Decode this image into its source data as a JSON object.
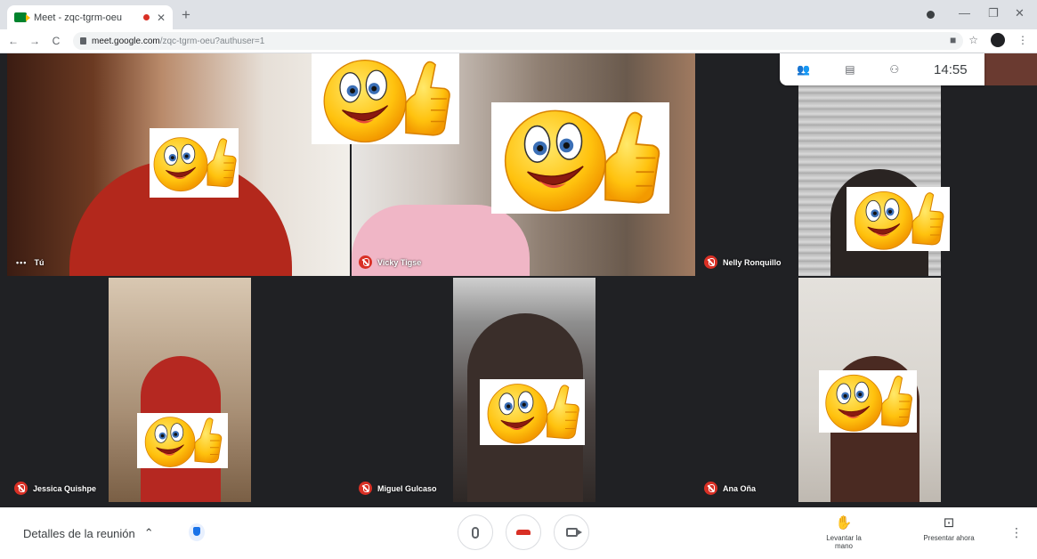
{
  "browser": {
    "tab_title": "Meet - zqc-tgrm-oeu",
    "tab_close": "✕",
    "new_tab": "+",
    "window_controls": [
      "—",
      "❐",
      "✕"
    ],
    "nav": [
      "←",
      "→",
      "C"
    ],
    "url_host": "meet.google.com",
    "url_path": "/zqc-tgrm-oeu?authuser=1",
    "toolbar_icons": [
      "■",
      "☆",
      "⋮"
    ]
  },
  "meeting": {
    "time": "14:55",
    "top_icons": [
      "people-icon",
      "chat-icon",
      "activities-icon"
    ],
    "top_glyphs": [
      "👥",
      "▤",
      "⚇"
    ]
  },
  "participants": [
    {
      "name": "Tú",
      "muted": false,
      "emoji": true
    },
    {
      "name": "Vicky Tigse",
      "muted": true,
      "emoji": true
    },
    {
      "name": "Nelly Ronquillo",
      "muted": true,
      "emoji": true
    },
    {
      "name": "Jessica Quishpe",
      "muted": true,
      "emoji": true
    },
    {
      "name": "Miguel Gulcaso",
      "muted": true,
      "emoji": true
    },
    {
      "name": "Ana Oña",
      "muted": true,
      "emoji": true
    }
  ],
  "bottom": {
    "details_label": "Detalles de la reunión",
    "details_chevron": "⌃",
    "raise_hand_label": "Levantar la mano",
    "present_label": "Presentar ahora",
    "raise_hand_glyph": "✋",
    "present_glyph": "⊡",
    "more_glyph": "⋮"
  },
  "colors": {
    "stage_bg": "#202124",
    "muted_badge": "#d93025",
    "hangup": "#d93025",
    "accent": "#1a73e8"
  }
}
